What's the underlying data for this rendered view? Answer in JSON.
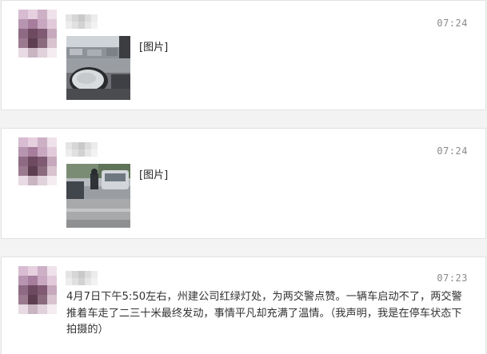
{
  "messages": [
    {
      "time": "07:24",
      "type": "image",
      "image_label": "[图片]",
      "photo_subject": "side mirror of car on street"
    },
    {
      "time": "07:24",
      "type": "image",
      "image_label": "[图片]",
      "photo_subject": "traffic police pushing a stalled car"
    },
    {
      "time": "07:23",
      "type": "text",
      "text": "4月7日下午5:50左右，州建公司红绿灯处，为两交警点赞。一辆车启动不了，两交警推着车走了二三十米最终发动，事情平凡却充满了温情。（我声明，我是在停车状态下拍摄的）"
    }
  ],
  "colors": {
    "background": "#f3f3f3",
    "card": "#ffffff",
    "card_border": "#e2e2e2",
    "time_text": "#8a8a8a",
    "body_text": "#333333"
  }
}
